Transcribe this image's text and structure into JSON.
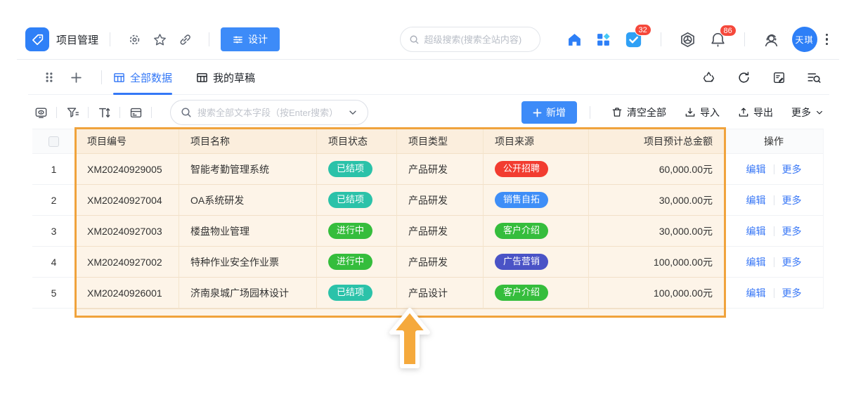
{
  "topbar": {
    "app_title": "项目管理",
    "design_label": "设计",
    "search_placeholder": "超级搜索(搜索全站内容)",
    "todo_badge": "32",
    "notify_badge": "86",
    "avatar_text": "天琪"
  },
  "tabs": {
    "items": [
      {
        "label": "全部数据",
        "active": true
      },
      {
        "label": "我的草稿",
        "active": false
      }
    ]
  },
  "toolbar": {
    "search_placeholder": "搜索全部文本字段（按Enter搜索）",
    "add_label": "新增",
    "clear_label": "清空全部",
    "import_label": "导入",
    "export_label": "导出",
    "more_label": "更多"
  },
  "table": {
    "columns": [
      "项目编号",
      "项目名称",
      "项目状态",
      "项目类型",
      "项目来源",
      "项目预计总金额",
      "操作"
    ],
    "edit_label": "编辑",
    "more_label": "更多",
    "status_colors": {
      "已结项": "#2bc2a9",
      "进行中": "#35bd3c"
    },
    "source_colors": {
      "公开招聘": "#f23c30",
      "销售自拓": "#3e8ef7",
      "客户介绍": "#35bd3c",
      "广告营销": "#4a53c6"
    },
    "rows": [
      {
        "index": "1",
        "code": "XM20240929005",
        "name": "智能考勤管理系统",
        "status": "已结项",
        "type": "产品研发",
        "source": "公开招聘",
        "amount": "60,000.00元"
      },
      {
        "index": "2",
        "code": "XM20240927004",
        "name": "OA系统研发",
        "status": "已结项",
        "type": "产品研发",
        "source": "销售自拓",
        "amount": "30,000.00元"
      },
      {
        "index": "3",
        "code": "XM20240927003",
        "name": "楼盘物业管理",
        "status": "进行中",
        "type": "产品研发",
        "source": "客户介绍",
        "amount": "30,000.00元"
      },
      {
        "index": "4",
        "code": "XM20240927002",
        "name": "特种作业安全作业票",
        "status": "进行中",
        "type": "产品研发",
        "source": "广告营销",
        "amount": "100,000.00元"
      },
      {
        "index": "5",
        "code": "XM20240926001",
        "name": "济南泉城广场园林设计",
        "status": "已结项",
        "type": "产品设计",
        "source": "客户介绍",
        "amount": "100,000.00元"
      }
    ]
  },
  "colors": {
    "accent_blue": "#3d8bf8",
    "link_blue": "#3877f6",
    "highlight_orange": "#f0a33c",
    "badge_red": "#f5483b",
    "highlight_row_bg": "#fdf4e8"
  }
}
